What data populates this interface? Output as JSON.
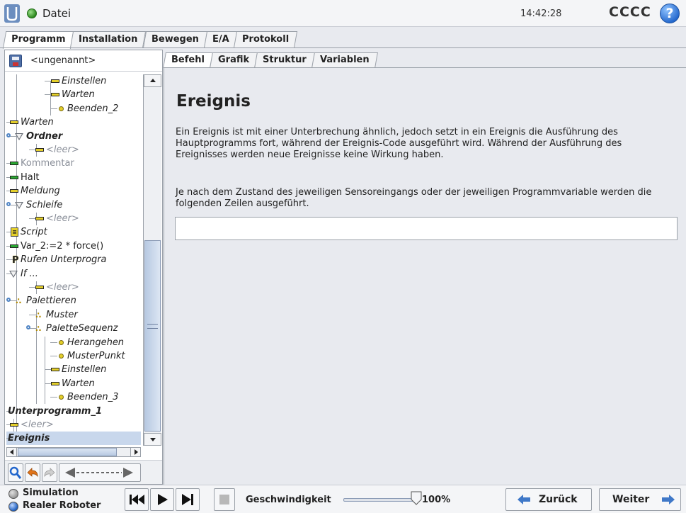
{
  "header": {
    "file_menu": "Datei",
    "clock": "14:42:28",
    "robot_name": "CCCC",
    "help_symbol": "?"
  },
  "main_tabs": [
    {
      "label": "Programm",
      "active": true
    },
    {
      "label": "Installation",
      "active": false
    },
    {
      "label": "Bewegen",
      "active": false
    },
    {
      "label": "E/A",
      "active": false
    },
    {
      "label": "Protokoll",
      "active": false
    }
  ],
  "program": {
    "name": "<ungenannt>"
  },
  "tree": [
    {
      "label": "Einstellen",
      "icon": "set-bar-icon",
      "style": "it"
    },
    {
      "label": "Warten",
      "icon": "wait-bar-icon",
      "style": "it"
    },
    {
      "label": "Beenden_2",
      "icon": "waypoint-icon",
      "style": "it"
    },
    {
      "label": "Warten",
      "icon": "wait-bar-icon",
      "style": "it"
    },
    {
      "label": "Ordner",
      "icon": "folder-icon",
      "style": "bd"
    },
    {
      "label": "<leer>",
      "icon": "empty-bar-icon",
      "style": "gray it"
    },
    {
      "label": "Kommentar",
      "icon": "comment-bar-icon",
      "style": "gray"
    },
    {
      "label": "Halt",
      "icon": "halt-bar-icon",
      "style": ""
    },
    {
      "label": "Meldung",
      "icon": "popup-bar-icon",
      "style": "it"
    },
    {
      "label": "Schleife",
      "icon": "loop-icon",
      "style": "it"
    },
    {
      "label": "<leer>",
      "icon": "empty-bar-icon",
      "style": "gray it"
    },
    {
      "label": "Script",
      "icon": "script-icon",
      "style": "it"
    },
    {
      "label": "Var_2:=2 * force()",
      "icon": "assign-bar-icon",
      "style": ""
    },
    {
      "label": "Rufen Unterprogra",
      "icon": "call-icon",
      "style": "it"
    },
    {
      "label": "If ...",
      "icon": "if-icon",
      "style": "it"
    },
    {
      "label": "<leer>",
      "icon": "empty-bar-icon",
      "style": "gray it"
    },
    {
      "label": "Palettieren",
      "icon": "pallet-icon",
      "style": "it"
    },
    {
      "label": "Muster",
      "icon": "pattern-icon",
      "style": "it"
    },
    {
      "label": "PaletteSequenz",
      "icon": "pallet-sequence-icon",
      "style": "it"
    },
    {
      "label": "Herangehen",
      "icon": "waypoint-icon",
      "style": "it"
    },
    {
      "label": "MusterPunkt",
      "icon": "waypoint-icon",
      "style": "it"
    },
    {
      "label": "Einstellen",
      "icon": "set-bar-icon",
      "style": "it"
    },
    {
      "label": "Warten",
      "icon": "wait-bar-icon",
      "style": "it"
    },
    {
      "label": "Beenden_3",
      "icon": "waypoint-icon",
      "style": "it"
    },
    {
      "label": "Unterprogramm_1",
      "icon": "subprogram-icon",
      "style": "bd"
    },
    {
      "label": "<leer>",
      "icon": "empty-bar-icon",
      "style": "gray it"
    },
    {
      "label": "Ereignis",
      "icon": "event-icon",
      "style": "bd"
    }
  ],
  "right_tabs": [
    {
      "label": "Befehl",
      "active": true
    },
    {
      "label": "Grafik",
      "active": false
    },
    {
      "label": "Struktur",
      "active": false
    },
    {
      "label": "Variablen",
      "active": false
    }
  ],
  "command": {
    "title": "Ereignis",
    "paragraph1": "Ein Ereignis ist mit einer Unterbrechung ähnlich, jedoch setzt in ein Ereignis die Ausführung des Hauptprogramms fort, während der Ereignis-Code ausgeführt wird. Während der Ausführung des Ereignisses werden neue Ereignisse keine Wirkung haben.",
    "paragraph2": "Je nach dem Zustand des jeweiligen Sensoreingangs oder der jeweiligen Programmvariable werden die folgenden Zeilen ausgeführt.",
    "condition_value": ""
  },
  "footer": {
    "simulation": "Simulation",
    "real_robot": "Realer Roboter",
    "mode_selected": "real_robot",
    "speed_label": "Geschwindigkeit",
    "speed_value": "100%",
    "speed_fraction": 1.0,
    "back": "Zurück",
    "next": "Weiter"
  },
  "colors": {
    "accent_blue": "#2266cc",
    "selection": "#c8d7ec",
    "status_green": "#2d8a1f",
    "icon_yellow": "#e4cf2a"
  }
}
